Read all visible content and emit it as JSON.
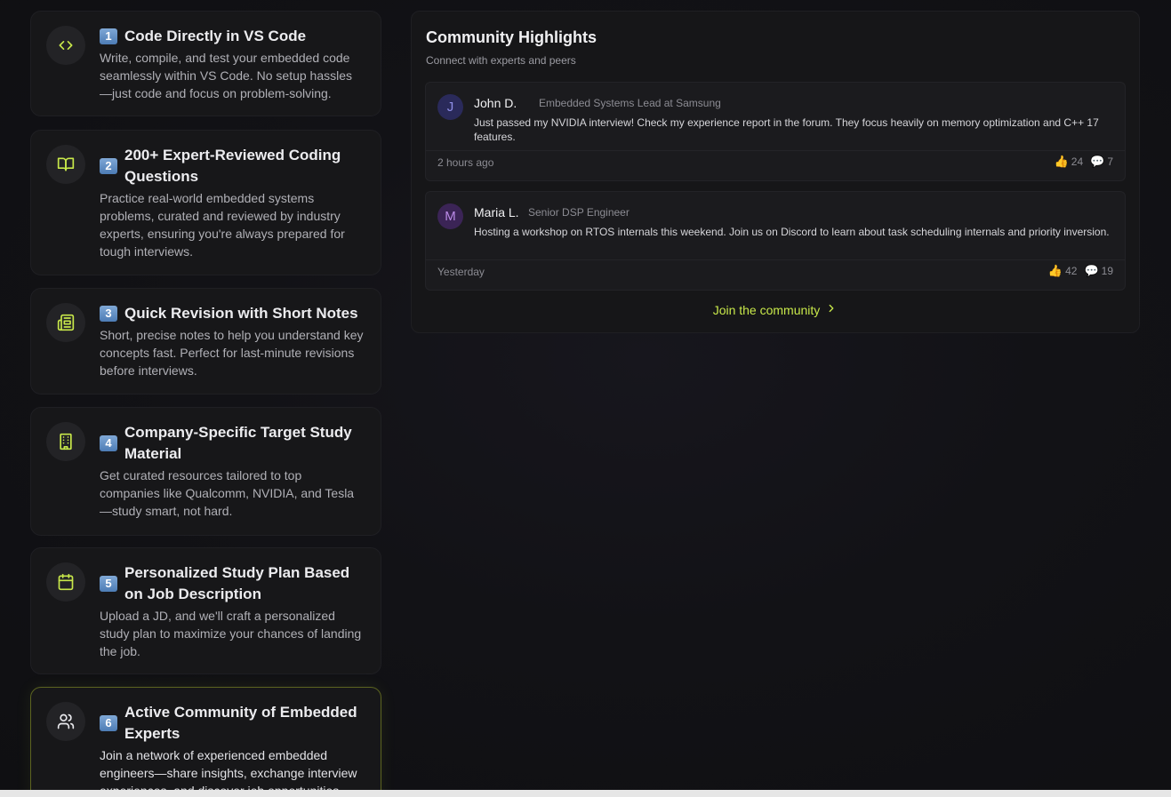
{
  "features": [
    {
      "badge": "1",
      "title": "Code Directly in VS Code",
      "description": "Write, compile, and test your embedded code seamlessly within VS Code. No setup hassles—just code and focus on problem-solving.",
      "icon": "code-icon"
    },
    {
      "badge": "2",
      "title": "200+ Expert-Reviewed Coding Questions",
      "description": "Practice real-world embedded systems problems, curated and reviewed by industry experts, ensuring you're always prepared for tough interviews.",
      "icon": "book-open-icon"
    },
    {
      "badge": "3",
      "title": "Quick Revision with Short Notes",
      "description": "Short, precise notes to help you understand key concepts fast. Perfect for last-minute revisions before interviews.",
      "icon": "newspaper-icon"
    },
    {
      "badge": "4",
      "title": "Company-Specific Target Study Material",
      "description": "Get curated resources tailored to top companies like Qualcomm, NVIDIA, and Tesla—study smart, not hard.",
      "icon": "building-icon"
    },
    {
      "badge": "5",
      "title": "Personalized Study Plan Based on Job Description",
      "description": "Upload a JD, and we'll craft a personalized study plan to maximize your chances of landing the job.",
      "icon": "calendar-icon"
    },
    {
      "badge": "6",
      "title": "Active Community of Embedded Experts",
      "description": "Join a network of experienced embedded engineers—share insights, exchange interview experiences, and discover job opportunities.",
      "icon": "users-icon"
    }
  ],
  "community": {
    "title": "Community Highlights",
    "subtitle": "Connect with experts and peers",
    "posts": [
      {
        "initial": "J",
        "name": "John D.",
        "role": "Embedded Systems Lead at Samsung",
        "text": "Just passed my NVIDIA interview! Check my experience report in the forum. They focus heavily on memory optimization and C++ 17 features.",
        "time": "2 hours ago",
        "likes": "24",
        "comments": "7",
        "avatar_bg": "#2a2a5a",
        "avatar_fg": "#8f8fe6"
      },
      {
        "initial": "M",
        "name": "Maria L.",
        "role": "Senior DSP Engineer",
        "text": "Hosting a workshop on RTOS internals this weekend. Join us on Discord to learn about task scheduling internals and priority inversion.",
        "time": "Yesterday",
        "likes": "42",
        "comments": "19",
        "avatar_bg": "#3b2456",
        "avatar_fg": "#b98ae6"
      }
    ],
    "join_label": "Join the community"
  },
  "colors": {
    "accent": "#c8e84a",
    "card_bg": "#171719",
    "page_bg": "#121216"
  }
}
